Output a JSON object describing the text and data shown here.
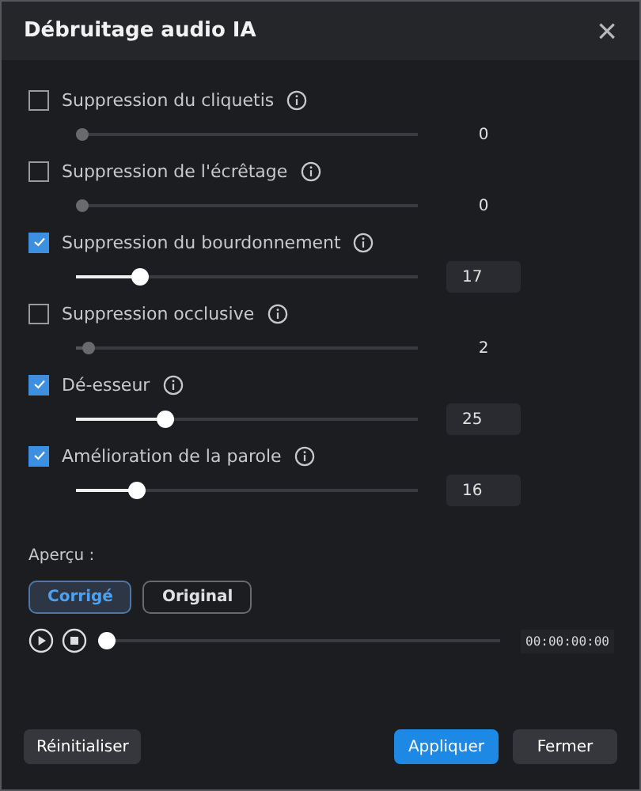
{
  "window": {
    "title": "Débruitage audio IA",
    "close": "×"
  },
  "effects": [
    {
      "label": "Suppression du cliquetis",
      "checked": false,
      "level": 0,
      "value": "0"
    },
    {
      "label": "Suppression de l'écrêtage",
      "checked": false,
      "level": 0,
      "value": "0"
    },
    {
      "label": "Suppression du bourdonnement",
      "checked": true,
      "level": 0.17,
      "value": "17"
    },
    {
      "label": "Suppression occlusive",
      "checked": false,
      "level": 0.02,
      "value": "2"
    },
    {
      "label": "Dé-esseur",
      "checked": true,
      "level": 0.25,
      "value": "25"
    },
    {
      "label": "Amélioration de la parole",
      "checked": true,
      "level": 0.16,
      "value": "16"
    }
  ],
  "preview": {
    "label": "Aperçu :",
    "options": [
      {
        "label": "Corrigé",
        "selected": true
      },
      {
        "label": "Original",
        "selected": false
      }
    ],
    "player": {
      "level": 0,
      "time": "00:00:00:00"
    }
  },
  "buttons": [
    {
      "label": "Réinitialiser",
      "kind": "secondary"
    },
    {
      "label": "Appliquer",
      "kind": "primary"
    },
    {
      "label": "Fermer",
      "kind": "secondary"
    }
  ]
}
